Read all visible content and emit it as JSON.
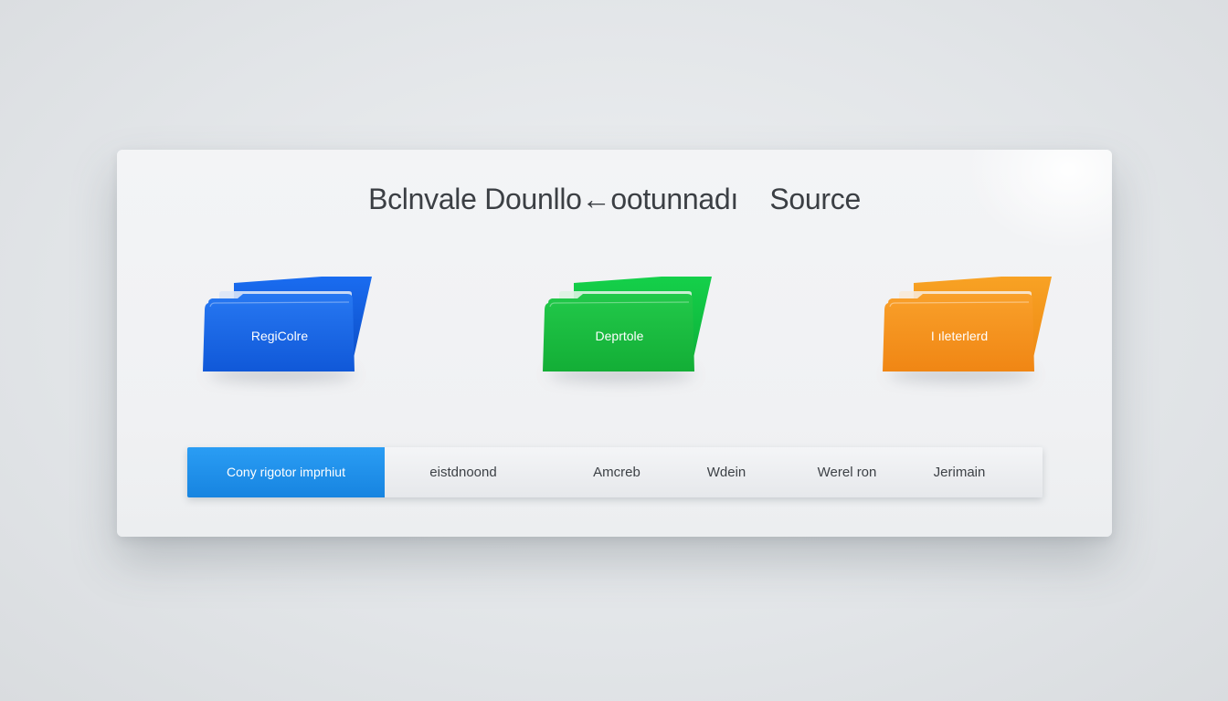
{
  "title": "Bclnvale Dounllo←ootunnadı    Source",
  "folders": [
    {
      "label": "RegiColre",
      "color": "#1763e6",
      "back_color": "#0f56d8"
    },
    {
      "label": "Deprtole",
      "color": "#19c23f",
      "back_color": "#10c83c"
    },
    {
      "label": "I ıleterlerd",
      "color": "#f5921c",
      "back_color": "#f79a1d"
    }
  ],
  "tabs": [
    {
      "label": "Cony rigotor imprhiut",
      "active": true
    },
    {
      "label": "eistdnoond",
      "active": false
    },
    {
      "label": "Amcreb",
      "active": false
    },
    {
      "label": "Wdein",
      "active": false
    },
    {
      "label": "Werel ron",
      "active": false
    },
    {
      "label": "Jerimain",
      "active": false
    }
  ],
  "colors": {
    "accent": "#1e8ee8",
    "blue": "#1763e6",
    "green": "#19c23f",
    "orange": "#f5921c"
  }
}
